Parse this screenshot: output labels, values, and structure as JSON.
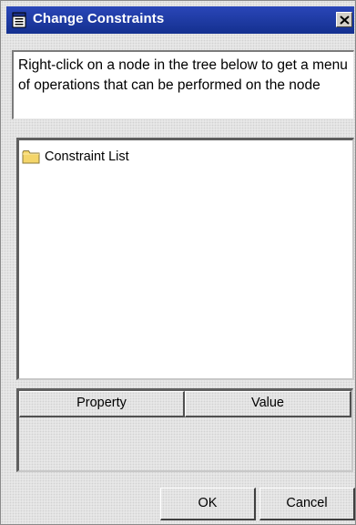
{
  "window": {
    "title": "Change Constraints",
    "close_glyph": "✕"
  },
  "info": {
    "text": "Right-click on a node in the tree below to get a menu of operations that can be performed on the node"
  },
  "tree": {
    "nodes": [
      {
        "label": "Constraint List",
        "icon": "folder-icon"
      }
    ]
  },
  "properties": {
    "columns": [
      "Property",
      "Value"
    ],
    "rows": []
  },
  "buttons": {
    "ok": "OK",
    "cancel": "Cancel"
  },
  "colors": {
    "titlebar": "#1f39a6",
    "folder": "#f4d56a"
  }
}
